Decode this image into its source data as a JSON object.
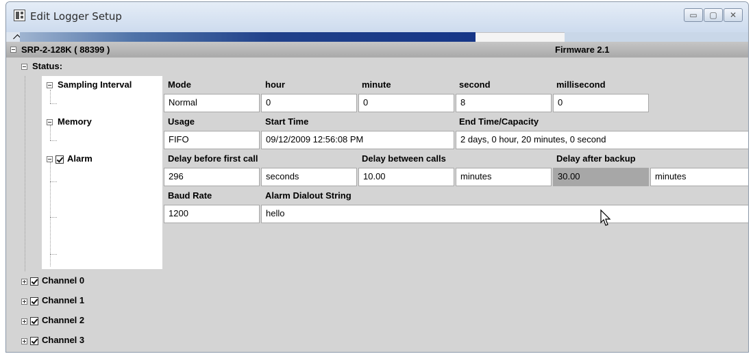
{
  "window": {
    "title": "Edit Logger Setup",
    "buttons": {
      "minimize": "▭",
      "maximize": "▢",
      "close": "✕"
    }
  },
  "device": {
    "name": "SRP-2-128K ( 88399 )",
    "firmware": "Firmware 2.1"
  },
  "status": {
    "label": "Status:",
    "sampling": {
      "label": "Sampling Interval",
      "headers": [
        "Mode",
        "hour",
        "minute",
        "second",
        "millisecond"
      ],
      "values": [
        "Normal",
        "0",
        "0",
        "8",
        "0"
      ]
    },
    "memory": {
      "label": "Memory",
      "headers": [
        "Usage",
        "Start Time",
        "End Time/Capacity"
      ],
      "values": [
        "FIFO",
        "09/12/2009 12:56:08 PM",
        " 2 days, 0 hour, 20 minutes, 0 second"
      ]
    },
    "alarm": {
      "label": "Alarm",
      "headers": [
        "Delay before first call",
        "Delay between calls",
        "Delay after backup"
      ],
      "first_call_value": "296",
      "first_call_unit": "seconds",
      "between_calls_value": "10.00",
      "between_calls_unit": "minutes",
      "after_backup_value": "30.00",
      "after_backup_unit": "minutes",
      "headers2": [
        "Baud Rate",
        "Alarm Dialout String"
      ],
      "baud_rate": "1200",
      "dialout_string": "hello"
    }
  },
  "channels": [
    "Channel 0",
    "Channel 1",
    "Channel 2",
    "Channel 3"
  ]
}
